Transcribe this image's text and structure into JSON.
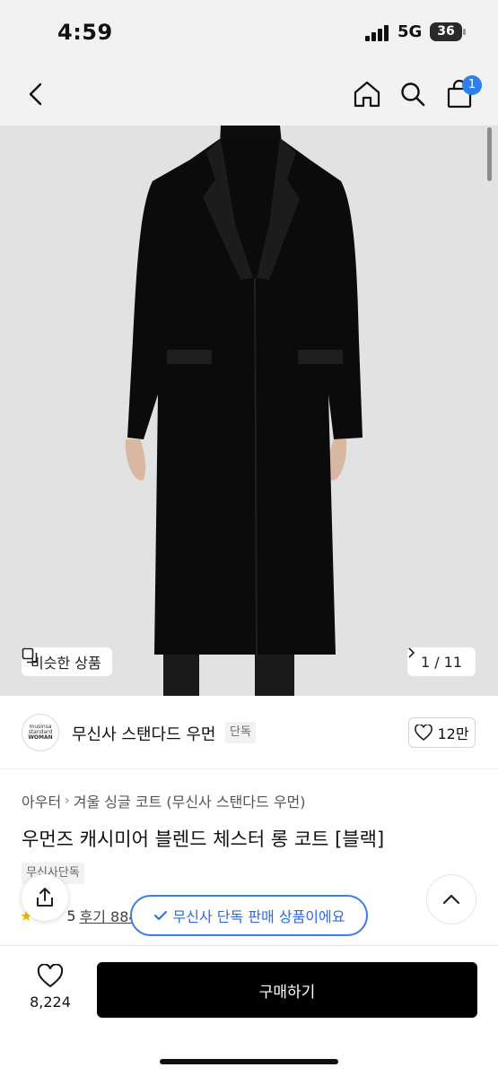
{
  "status_bar": {
    "time": "4:59",
    "network": "5G",
    "battery": "36"
  },
  "nav": {
    "cart_count": "1"
  },
  "hero": {
    "similar_label": "비슷한 상품",
    "page_indicator": "1 / 11"
  },
  "brand": {
    "logo_lines": [
      "musinsa",
      "standard",
      "WOMAN"
    ],
    "name": "무신사 스탠다드 우먼",
    "exclusive_tag": "단독",
    "likes": "12만"
  },
  "product": {
    "breadcrumb": [
      "아우터",
      "겨울 싱글 코트 (무신사 스탠다드 우먼)"
    ],
    "title": "우먼즈 캐시미어 블렌드 체스터 롱 코트 [블랙]",
    "exclusive_badge": "무신사단독",
    "rating_visible": "5",
    "review_label": "후기 884"
  },
  "toast": {
    "text": "무신사 단독 판매 상품이에요"
  },
  "bottom": {
    "wish_count": "8,224",
    "buy_label": "구매하기"
  },
  "colors": {
    "accent": "#2f6ae0",
    "badge": "#2f80ed",
    "buy_bg": "#000000"
  }
}
